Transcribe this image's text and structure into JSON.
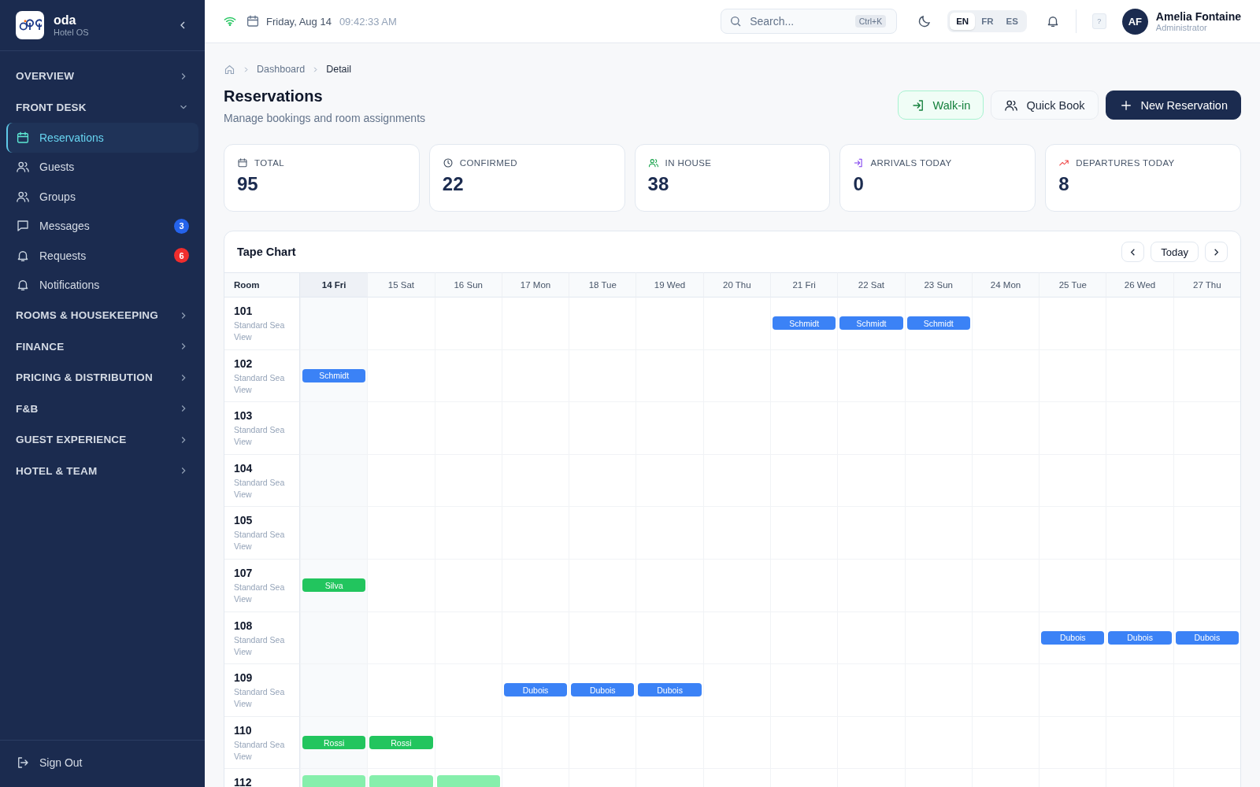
{
  "sidebar": {
    "brand": {
      "name": "oda",
      "subtitle": "Hotel OS"
    },
    "sections": [
      {
        "label": "OVERVIEW",
        "expanded": false
      },
      {
        "label": "FRONT DESK",
        "expanded": true,
        "items": [
          {
            "label": "Reservations",
            "kind": "calendar",
            "selected": true
          },
          {
            "label": "Guests",
            "kind": "users",
            "selected": false
          },
          {
            "label": "Groups",
            "kind": "users",
            "selected": false
          },
          {
            "label": "Messages",
            "kind": "message",
            "selected": false,
            "badge": {
              "text": "3",
              "color": "#2563eb"
            }
          },
          {
            "label": "Requests",
            "kind": "bell",
            "selected": false,
            "badge": {
              "text": "6",
              "color": "#ef2d2d"
            }
          },
          {
            "label": "Notifications",
            "kind": "bell",
            "selected": false
          }
        ]
      },
      {
        "label": "ROOMS & HOUSEKEEPING",
        "expanded": false
      },
      {
        "label": "FINANCE",
        "expanded": false
      },
      {
        "label": "PRICING & DISTRIBUTION",
        "expanded": false
      },
      {
        "label": "F&B",
        "expanded": false
      },
      {
        "label": "GUEST EXPERIENCE",
        "expanded": false
      },
      {
        "label": "HOTEL & TEAM",
        "expanded": false
      }
    ],
    "footer": {
      "label": "Sign Out"
    }
  },
  "header": {
    "date": "Friday, Aug 14",
    "time": "09:42:33 AM",
    "search": {
      "placeholder": "Search...",
      "shortcut": "Ctrl+K"
    },
    "languages": [
      {
        "label": "EN",
        "selected": true
      },
      {
        "label": "FR",
        "selected": false
      },
      {
        "label": "ES",
        "selected": false
      }
    ],
    "help": "?",
    "user": {
      "initials": "AF",
      "name": "Amelia Fontaine",
      "role": "Administrator"
    }
  },
  "breadcrumb": [
    "Dashboard",
    "Detail"
  ],
  "page": {
    "title": "Reservations",
    "subtitle": "Manage bookings and room assignments"
  },
  "actions": [
    {
      "label": "Walk-in",
      "kind": "walkin"
    },
    {
      "label": "Quick Book",
      "kind": "quick"
    },
    {
      "label": "New Reservation",
      "kind": "primary"
    }
  ],
  "stats": [
    {
      "label": "TOTAL",
      "value": "95",
      "kind": "calendar"
    },
    {
      "label": "CONFIRMED",
      "value": "22",
      "kind": "clock"
    },
    {
      "label": "IN HOUSE",
      "value": "38",
      "kind": "users"
    },
    {
      "label": "ARRIVALS TODAY",
      "value": "0",
      "kind": "arrival"
    },
    {
      "label": "DEPARTURES TODAY",
      "value": "8",
      "kind": "trend"
    }
  ],
  "tape_chart": {
    "title": "Tape Chart",
    "today_button": "Today",
    "room_header": "Room",
    "days": [
      {
        "label": "14 Fri",
        "selected": true
      },
      {
        "label": "15 Sat",
        "selected": false
      },
      {
        "label": "16 Sun",
        "selected": false
      },
      {
        "label": "17 Mon",
        "selected": false
      },
      {
        "label": "18 Tue",
        "selected": false
      },
      {
        "label": "19 Wed",
        "selected": false
      },
      {
        "label": "20 Thu",
        "selected": false
      },
      {
        "label": "21 Fri",
        "selected": false
      },
      {
        "label": "22 Sat",
        "selected": false
      },
      {
        "label": "23 Sun",
        "selected": false
      },
      {
        "label": "24 Mon",
        "selected": false
      },
      {
        "label": "25 Tue",
        "selected": false
      },
      {
        "label": "26 Wed",
        "selected": false
      },
      {
        "label": "27 Thu",
        "selected": false
      }
    ],
    "rooms": [
      {
        "number": "101",
        "type": "Standard Sea View",
        "nights": [
          {
            "booked": false
          },
          {
            "booked": false
          },
          {
            "booked": false
          },
          {
            "booked": false
          },
          {
            "booked": false
          },
          {
            "booked": false
          },
          {
            "booked": false
          },
          {
            "booked": true,
            "guest": "Schmidt",
            "color": "#3b82f6"
          },
          {
            "booked": true,
            "guest": "Schmidt",
            "color": "#3b82f6"
          },
          {
            "booked": true,
            "guest": "Schmidt",
            "color": "#3b82f6"
          },
          {
            "booked": false
          },
          {
            "booked": false
          },
          {
            "booked": false
          },
          {
            "booked": false
          }
        ]
      },
      {
        "number": "102",
        "type": "Standard Sea View",
        "nights": [
          {
            "booked": true,
            "guest": "Schmidt",
            "color": "#3b82f6"
          },
          {
            "booked": false
          },
          {
            "booked": false
          },
          {
            "booked": false
          },
          {
            "booked": false
          },
          {
            "booked": false
          },
          {
            "booked": false
          },
          {
            "booked": false
          },
          {
            "booked": false
          },
          {
            "booked": false
          },
          {
            "booked": false
          },
          {
            "booked": false
          },
          {
            "booked": false
          },
          {
            "booked": false
          }
        ]
      },
      {
        "number": "103",
        "type": "Standard Sea View"
      },
      {
        "number": "104",
        "type": "Standard Sea View"
      },
      {
        "number": "105",
        "type": "Standard Sea View"
      },
      {
        "number": "107",
        "type": "Standard Sea View",
        "nights": [
          {
            "booked": true,
            "guest": "Silva",
            "color": "#22c55e"
          },
          {
            "booked": false
          },
          {
            "booked": false
          },
          {
            "booked": false
          },
          {
            "booked": false
          },
          {
            "booked": false
          },
          {
            "booked": false
          },
          {
            "booked": false
          },
          {
            "booked": false
          },
          {
            "booked": false
          },
          {
            "booked": false
          },
          {
            "booked": false
          },
          {
            "booked": false
          },
          {
            "booked": false
          }
        ]
      },
      {
        "number": "108",
        "type": "Standard Sea View",
        "nights": [
          {
            "booked": false
          },
          {
            "booked": false
          },
          {
            "booked": false
          },
          {
            "booked": false
          },
          {
            "booked": false
          },
          {
            "booked": false
          },
          {
            "booked": false
          },
          {
            "booked": false
          },
          {
            "booked": false
          },
          {
            "booked": false
          },
          {
            "booked": false
          },
          {
            "booked": true,
            "guest": "Dubois",
            "color": "#3b82f6"
          },
          {
            "booked": true,
            "guest": "Dubois",
            "color": "#3b82f6"
          },
          {
            "booked": true,
            "guest": "Dubois",
            "color": "#3b82f6"
          }
        ]
      },
      {
        "number": "109",
        "type": "Standard Sea View",
        "nights": [
          {
            "booked": false
          },
          {
            "booked": false
          },
          {
            "booked": false
          },
          {
            "booked": true,
            "guest": "Dubois",
            "color": "#3b82f6"
          },
          {
            "booked": true,
            "guest": "Dubois",
            "color": "#3b82f6"
          },
          {
            "booked": true,
            "guest": "Dubois",
            "color": "#3b82f6"
          },
          {
            "booked": false
          },
          {
            "booked": false
          },
          {
            "booked": false
          },
          {
            "booked": false
          },
          {
            "booked": false
          },
          {
            "booked": false
          },
          {
            "booked": false
          },
          {
            "booked": false
          }
        ]
      },
      {
        "number": "110",
        "type": "Standard Sea View",
        "nights": [
          {
            "booked": true,
            "guest": "Rossi",
            "color": "#22c55e"
          },
          {
            "booked": true,
            "guest": "Rossi",
            "color": "#22c55e"
          },
          {
            "booked": false
          },
          {
            "booked": false
          },
          {
            "booked": false
          },
          {
            "booked": false
          },
          {
            "booked": false
          },
          {
            "booked": false
          },
          {
            "booked": false
          },
          {
            "booked": false
          },
          {
            "booked": false
          },
          {
            "booked": false
          },
          {
            "booked": false
          },
          {
            "booked": false
          }
        ]
      },
      {
        "number": "112",
        "nights": [
          {
            "booked": true,
            "color": "#86efac"
          },
          {
            "booked": true,
            "color": "#86efac"
          },
          {
            "booked": true,
            "color": "#86efac"
          }
        ]
      }
    ]
  }
}
